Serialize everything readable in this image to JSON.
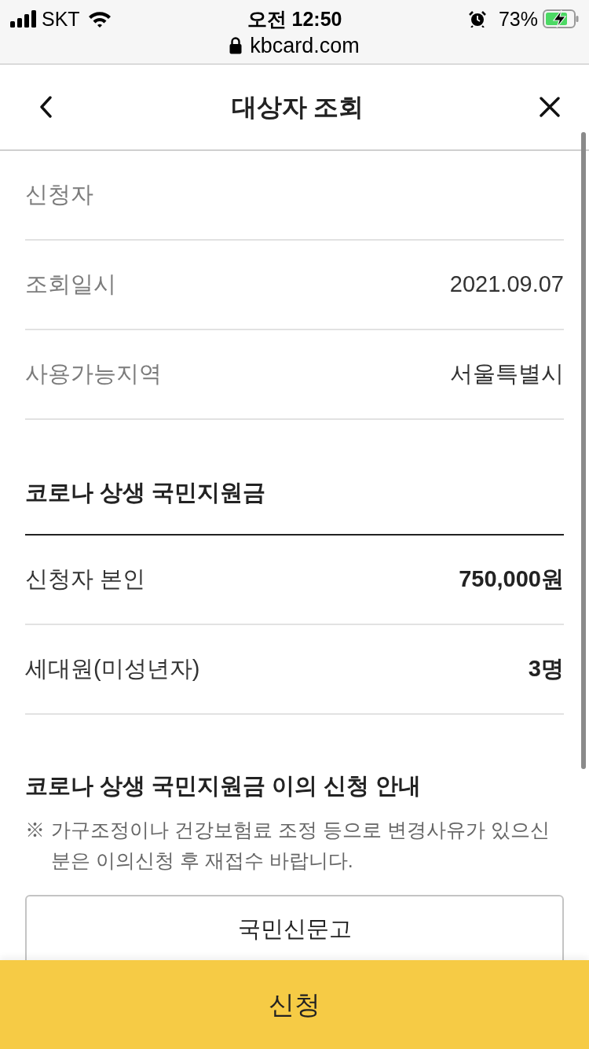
{
  "status_bar": {
    "carrier": "SKT",
    "time": "오전 12:50",
    "battery": "73%",
    "url": "kbcard.com"
  },
  "header": {
    "title": "대상자 조회"
  },
  "info_rows": [
    {
      "label": "신청자"
    },
    {
      "label": "조회일시",
      "value": "2021.09.07"
    },
    {
      "label": "사용가능지역",
      "value": "서울특별시"
    }
  ],
  "support_section": {
    "title": "코로나 상생 국민지원금",
    "rows": [
      {
        "label": "신청자 본인",
        "value": "750,000원"
      },
      {
        "label": "세대원(미성년자)",
        "value": "3명"
      }
    ]
  },
  "appeal_section": {
    "title": "코로나 상생 국민지원금 이의 신청 안내",
    "note_mark": "※",
    "note": "가구조정이나 건강보험료 조정 등으로 변경사유가 있으신 분은 이의신청 후 재접수 바랍니다.",
    "link_button": "국민신문고"
  },
  "apply_button": "신청"
}
